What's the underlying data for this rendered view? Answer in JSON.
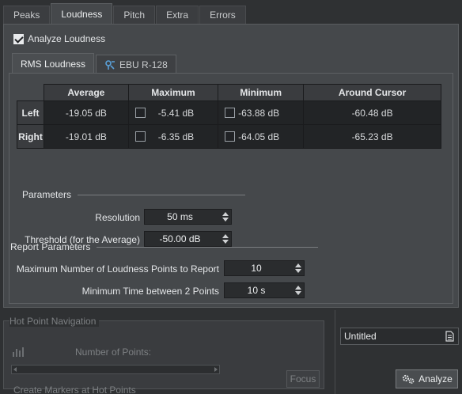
{
  "tabs": [
    "Peaks",
    "Loudness",
    "Pitch",
    "Extra",
    "Errors"
  ],
  "active_tab": "Loudness",
  "analyze_loudness": {
    "label": "Analyze Loudness",
    "checked": true
  },
  "subtabs": {
    "rms": "RMS Loudness",
    "ebu": "EBU R-128"
  },
  "table": {
    "headers": [
      "Average",
      "Maximum",
      "Minimum",
      "Around Cursor"
    ],
    "rows": [
      {
        "label": "Left",
        "average": "-19.05 dB",
        "maximum": "-5.41 dB",
        "minimum": "-63.88 dB",
        "around_cursor": "-60.48 dB"
      },
      {
        "label": "Right",
        "average": "-19.01 dB",
        "maximum": "-6.35 dB",
        "minimum": "-64.05 dB",
        "around_cursor": "-65.23 dB"
      }
    ]
  },
  "parameters": {
    "title": "Parameters",
    "resolution_label": "Resolution",
    "resolution_value": "50 ms",
    "threshold_label": "Threshold (for the Average)",
    "threshold_value": "-50.00 dB"
  },
  "report": {
    "title": "Report Parameters",
    "max_points_label": "Maximum Number of Loudness Points to Report",
    "max_points_value": "10",
    "min_time_label": "Minimum Time between 2 Points",
    "min_time_value": "10 s"
  },
  "hot_point": {
    "title": "Hot Point Navigation",
    "number_label": "Number of Points:",
    "markers_label": "Create Markers at Hot Points",
    "focus_label": "Focus"
  },
  "preset": {
    "value": "Untitled"
  },
  "analyze_button": "Analyze",
  "colors": {
    "background": "#2f3133",
    "panel": "#45484b",
    "cell": "#222426",
    "accent_ebu": "#5aa0d8"
  }
}
